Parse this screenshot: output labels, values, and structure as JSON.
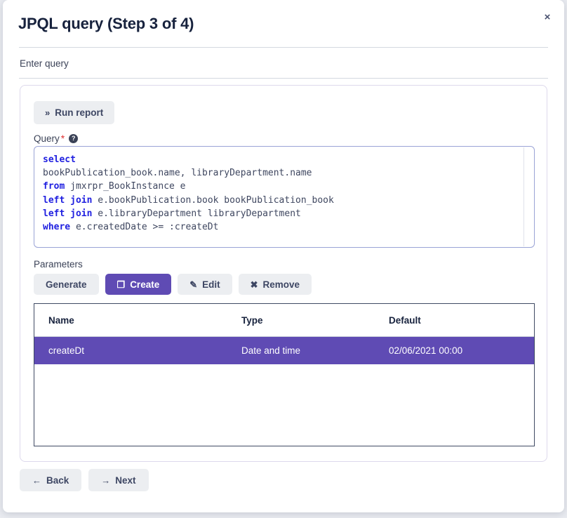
{
  "dialog": {
    "title": "JPQL query (Step 3 of 4)",
    "close_label": "×",
    "section_label": "Enter query"
  },
  "card": {
    "run_report": {
      "label": "Run report",
      "icon": "»",
      "icon_name": "double-chevron-right-icon"
    },
    "query_field": {
      "label": "Query",
      "required_marker": "*",
      "help_icon": "?",
      "value": "select\nbookPublication_book.name, libraryDepartment.name\nfrom jmxrpr_BookInstance e\nleft join e.bookPublication.book bookPublication_book\nleft join e.libraryDepartment libraryDepartment\nwhere e.createdDate >= :createDt",
      "lines": [
        {
          "keyword": "select",
          "rest": ""
        },
        {
          "keyword": "",
          "rest": "bookPublication_book.name, libraryDepartment.name"
        },
        {
          "keyword": "from",
          "rest": " jmxrpr_BookInstance e"
        },
        {
          "keyword": "left join",
          "rest": " e.bookPublication.book bookPublication_book"
        },
        {
          "keyword": "left join",
          "rest": " e.libraryDepartment libraryDepartment"
        },
        {
          "keyword": "where",
          "rest": " e.createdDate >= :createDt"
        }
      ]
    },
    "parameters": {
      "label": "Parameters",
      "buttons": [
        {
          "label": "Generate",
          "icon": "",
          "icon_name": "none",
          "primary": false
        },
        {
          "label": "Create",
          "icon": "❐",
          "icon_name": "document-icon",
          "primary": true
        },
        {
          "label": "Edit",
          "icon": "✎",
          "icon_name": "pencil-icon",
          "primary": false
        },
        {
          "label": "Remove",
          "icon": "✖",
          "icon_name": "cross-icon",
          "primary": false
        }
      ],
      "table": {
        "columns": [
          "Name",
          "Type",
          "Default"
        ],
        "rows": [
          {
            "name": "createDt",
            "type": "Date and time",
            "default": "02/06/2021 00:00",
            "selected": true
          }
        ]
      }
    }
  },
  "footer": {
    "buttons": [
      {
        "label": "Back",
        "icon": "←",
        "icon_name": "arrow-left-icon"
      },
      {
        "label": "Next",
        "icon": "→",
        "icon_name": "arrow-right-icon"
      }
    ]
  },
  "colors": {
    "accent_purple": "#5f4bb4",
    "title_text": "#17223d",
    "button_grey": "#eceef1",
    "keyword_blue": "#2020e0",
    "required_red": "#e03131",
    "backdrop": "#e9ebf0"
  }
}
